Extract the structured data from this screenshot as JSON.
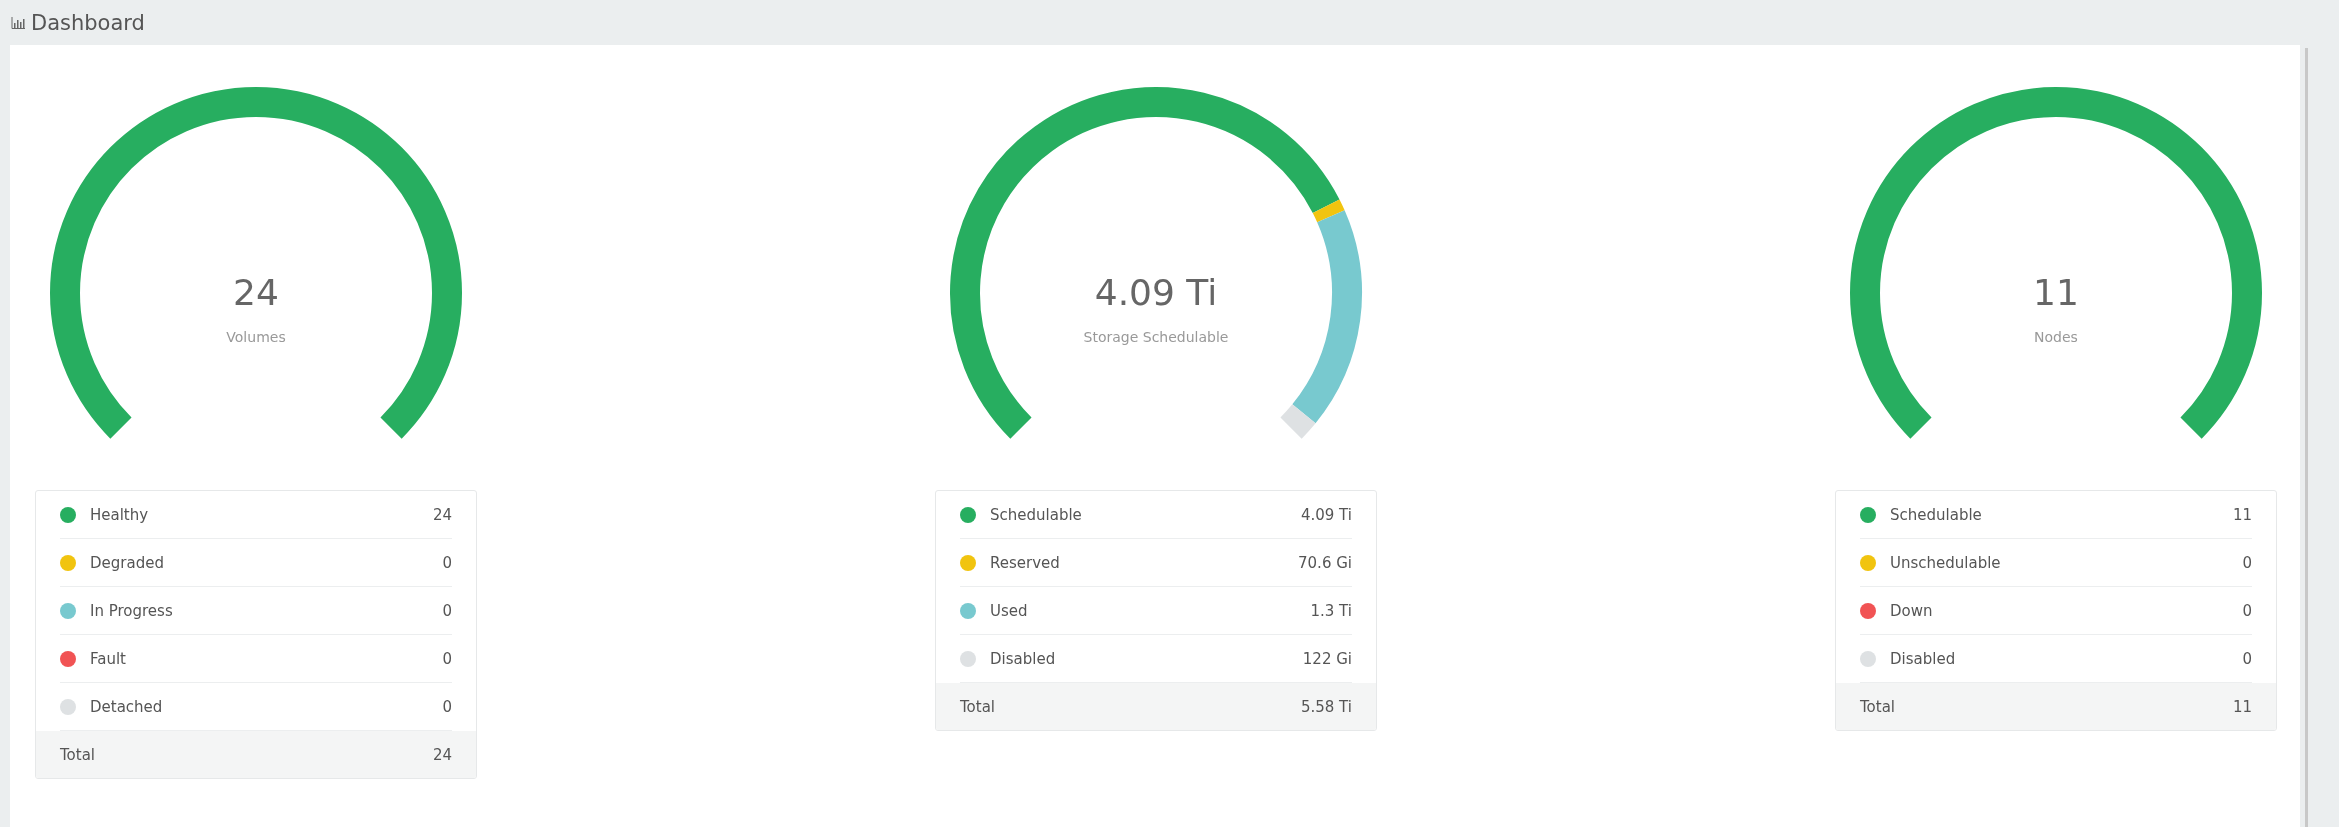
{
  "page": {
    "title": "Dashboard"
  },
  "panels": [
    {
      "value": "24",
      "label": "Volumes",
      "items": [
        {
          "label": "Healthy",
          "value": "24",
          "color": "#27ae60"
        },
        {
          "label": "Degraded",
          "value": "0",
          "color": "#f1c40f"
        },
        {
          "label": "In Progress",
          "value": "0",
          "color": "#78c9cf"
        },
        {
          "label": "Fault",
          "value": "0",
          "color": "#f15354"
        },
        {
          "label": "Detached",
          "value": "0",
          "color": "#dee1e3"
        }
      ],
      "total": {
        "label": "Total",
        "value": "24"
      }
    },
    {
      "value": "4.09 Ti",
      "label": "Storage Schedulable",
      "items": [
        {
          "label": "Schedulable",
          "value": "4.09 Ti",
          "color": "#27ae60"
        },
        {
          "label": "Reserved",
          "value": "70.6 Gi",
          "color": "#f1c40f"
        },
        {
          "label": "Used",
          "value": "1.3 Ti",
          "color": "#78c9cf"
        },
        {
          "label": "Disabled",
          "value": "122 Gi",
          "color": "#dee1e3"
        }
      ],
      "total": {
        "label": "Total",
        "value": "5.58 Ti"
      }
    },
    {
      "value": "11",
      "label": "Nodes",
      "items": [
        {
          "label": "Schedulable",
          "value": "11",
          "color": "#27ae60"
        },
        {
          "label": "Unschedulable",
          "value": "0",
          "color": "#f1c40f"
        },
        {
          "label": "Down",
          "value": "0",
          "color": "#f15354"
        },
        {
          "label": "Disabled",
          "value": "0",
          "color": "#dee1e3"
        }
      ],
      "total": {
        "label": "Total",
        "value": "11"
      }
    }
  ]
}
